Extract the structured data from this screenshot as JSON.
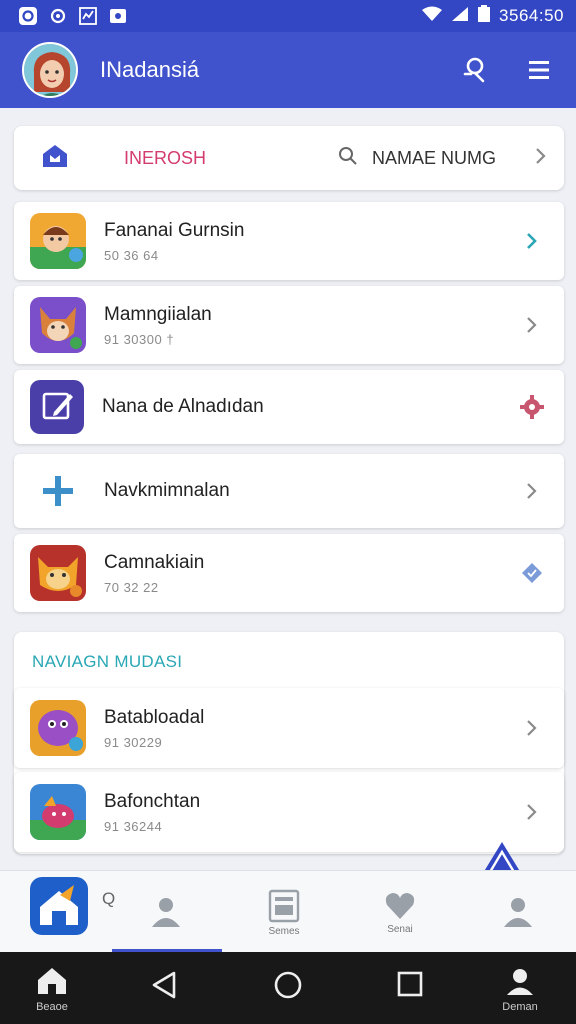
{
  "status_bar": {
    "time": "3564:50",
    "icons": [
      "circle-o-icon",
      "refresh-icon",
      "chart-icon",
      "image-icon",
      "wifi-icon",
      "signal-icon",
      "battery-icon"
    ]
  },
  "app_bar": {
    "title": "INadansiá",
    "actions": [
      "search-icon",
      "menu-icon"
    ]
  },
  "search_card": {
    "label": "INEROSH",
    "placeholder": "NAMAE NUMG"
  },
  "items": [
    {
      "title": "Fananai Gurnsin",
      "subtitle": "50 36 64"
    },
    {
      "title": "Mamngiialan",
      "subtitle": "91 30300 †"
    },
    {
      "title": "Nana de Alnadıdan",
      "subtitle": ""
    },
    {
      "title": "Navkmimnalan",
      "subtitle": ""
    },
    {
      "title": "Camnakiain",
      "subtitle": "70 32 22"
    }
  ],
  "section": {
    "title": "NAVIAGN MUDASI",
    "items": [
      {
        "title": "Batabloadal",
        "subtitle": "91 30229"
      },
      {
        "title": "Bafonchtan",
        "subtitle": "91 36244"
      }
    ]
  },
  "bottom_nav": {
    "items": [
      {
        "label": "Q"
      },
      {
        "label": ""
      },
      {
        "label": "Semes"
      },
      {
        "label": "Senai"
      },
      {
        "label": ""
      }
    ]
  },
  "system_nav": {
    "home_label": "Beaoe",
    "profile_label": "Deman"
  },
  "colors": {
    "primary": "#4052cc",
    "statusbar": "#3346c4",
    "accent_pink": "#d23c6e",
    "accent_teal": "#2aa7b5"
  }
}
